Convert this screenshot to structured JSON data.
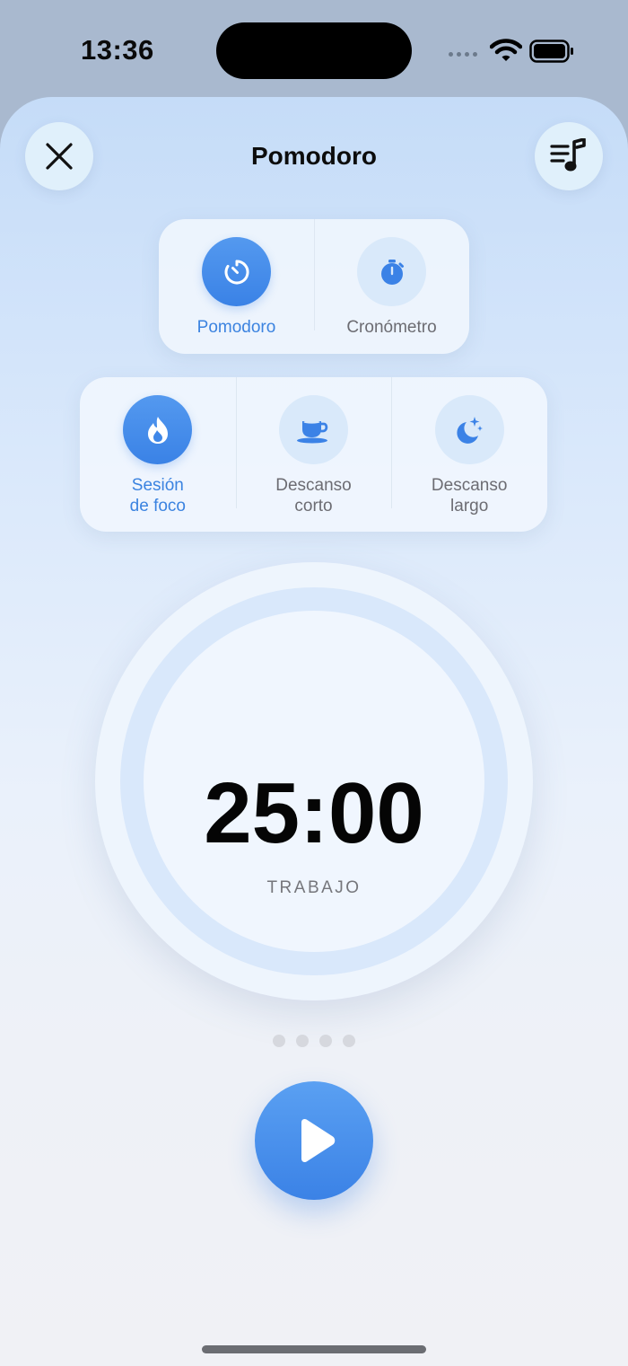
{
  "status_bar": {
    "time": "13:36"
  },
  "header": {
    "title": "Pomodoro",
    "close_icon": "close-icon",
    "music_icon": "music-list-icon"
  },
  "mode_selector": {
    "selected": "Pomodoro",
    "options": [
      {
        "label": "Pomodoro",
        "icon": "timer-icon",
        "active": true
      },
      {
        "label": "Cronómetro",
        "icon": "stopwatch-icon",
        "active": false
      }
    ]
  },
  "phase_selector": {
    "selected": "Sesión de foco",
    "options": [
      {
        "label": "Sesión\nde foco",
        "icon": "flame-icon",
        "active": true
      },
      {
        "label": "Descanso\ncorto",
        "icon": "coffee-cup-icon",
        "active": false
      },
      {
        "label": "Descanso\nlargo",
        "icon": "moon-stars-icon",
        "active": false
      }
    ]
  },
  "timer": {
    "value": "25:00",
    "label": "TRABAJO"
  },
  "session_dots": {
    "count": 4
  },
  "controls": {
    "play_icon": "play-icon"
  },
  "colors": {
    "accent": "#3B82E6",
    "accent_light": "#D9E9FA",
    "text_primary": "#050505",
    "text_secondary": "#6C6C72"
  }
}
